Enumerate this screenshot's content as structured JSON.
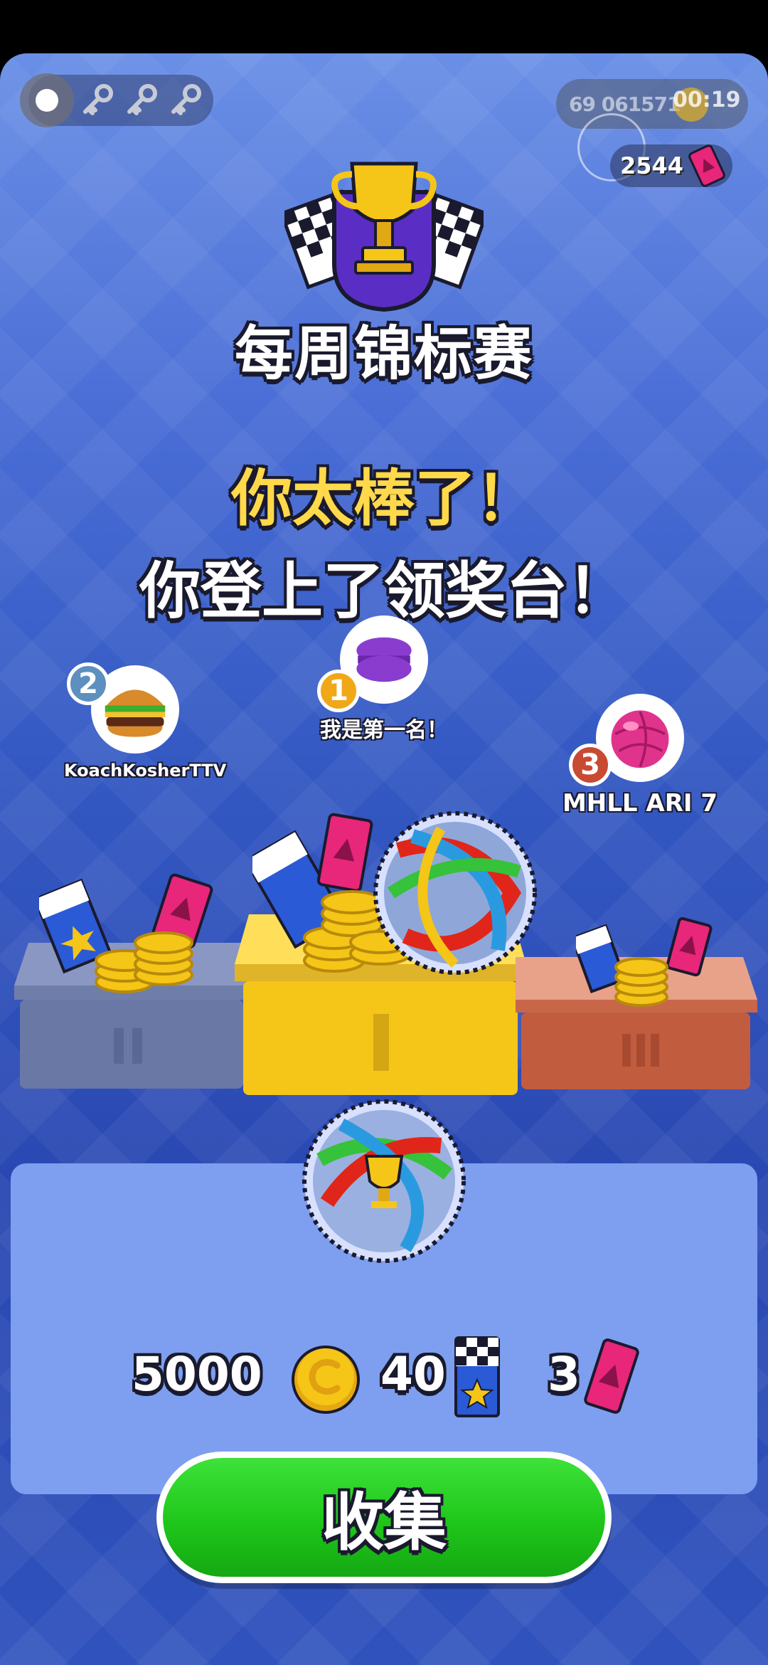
{
  "status_bar": {
    "status_digits": "69 061571",
    "timer": "00:19",
    "tickets": "2544"
  },
  "header": {
    "title": "每周锦标赛",
    "headline": "你太棒了！",
    "subheadline": "你登上了领奖台！"
  },
  "podium": {
    "first": {
      "rank": "1",
      "name": "我是第一名！",
      "avatar": "macaron-icon"
    },
    "second": {
      "rank": "2",
      "name": "KoachKosherTTV",
      "avatar": "burger-icon"
    },
    "third": {
      "rank": "3",
      "name": "MHLL ARI 7",
      "avatar": "pink-ball-icon"
    }
  },
  "rewards": {
    "coins": "5000",
    "flags": "40",
    "tickets": "3"
  },
  "collect_button": "收集",
  "colors": {
    "gold": "#f5c518",
    "silver": "#6f7ea8",
    "bronze": "#c8664a",
    "accent_yellow": "#ffd94a",
    "button_green": "#1fc61a"
  }
}
